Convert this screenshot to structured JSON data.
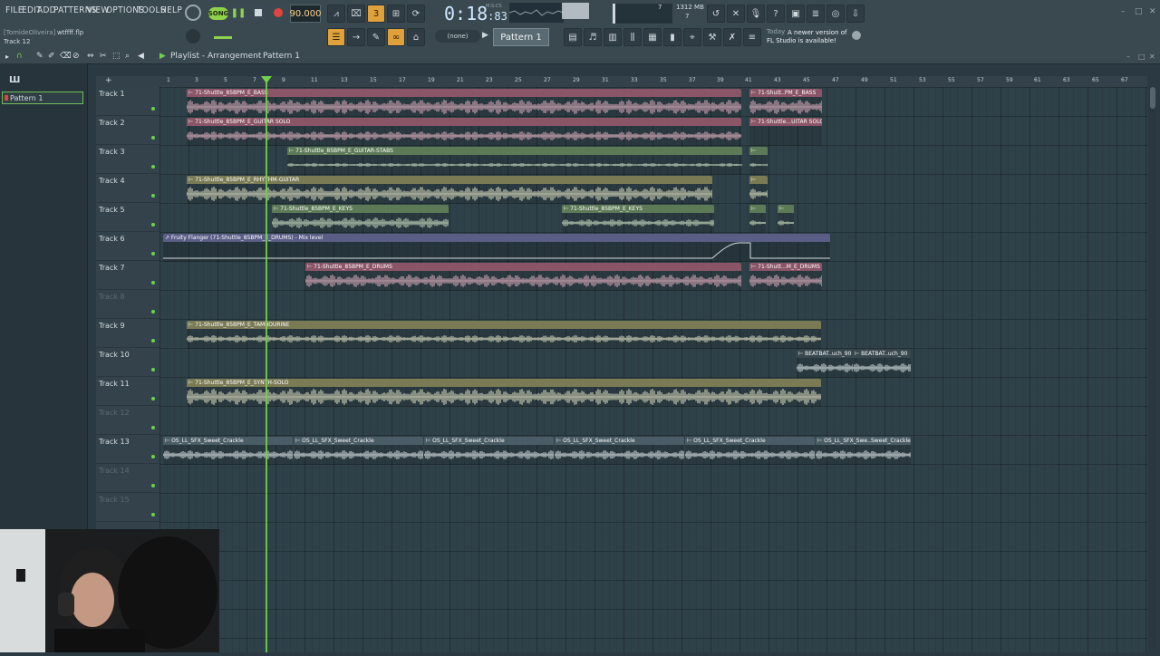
{
  "menu": [
    "FILE",
    "EDIT",
    "ADD",
    "PATTERNS",
    "VIEW",
    "OPTIONS",
    "TOOLS",
    "HELP"
  ],
  "transport": {
    "song_label": "SONG",
    "tempo": "90.000",
    "time_main": "0:18",
    "time_sub": ":83",
    "time_unit_label": "M:S:CS",
    "memory": "1312 MB",
    "memory_num": "7",
    "polyphony": "7"
  },
  "hint": {
    "user": "[TomideOliveira]",
    "file": "wtffff.flp",
    "track": "Track 12"
  },
  "toolbar": {
    "none_label": "(none)",
    "pattern_label": "Pattern 1"
  },
  "news": {
    "today": "Today",
    "line1": "A newer version of",
    "line2": "FL Studio is available!"
  },
  "playlist": {
    "title": "Playlist - Arrangement",
    "arrow": "›",
    "pattern": "Pattern 1",
    "pattern_list_item": "Pattern 1"
  },
  "ruler": [
    "1",
    "3",
    "5",
    "7",
    "9",
    "11",
    "13",
    "15",
    "17",
    "19",
    "21",
    "23",
    "25",
    "27",
    "29",
    "31",
    "33",
    "35",
    "37",
    "39",
    "41",
    "43",
    "45",
    "47",
    "49",
    "51",
    "53",
    "55",
    "57",
    "59",
    "61",
    "63",
    "65",
    "67"
  ],
  "tracks": [
    "Track 1",
    "Track 2",
    "Track 3",
    "Track 4",
    "Track 5",
    "Track 6",
    "Track 7",
    "Track 8",
    "Track 9",
    "Track 10",
    "Track 11",
    "Track 12",
    "Track 13",
    "Track 14",
    "Track 15"
  ],
  "clips": {
    "bass": "71-Shuttle_85BPM_E_BASS",
    "bass2": "71-Shutt..PM_E_BASS",
    "guitar_solo": "71-Shuttle_85BPM_E_GUITAR SOLO",
    "guitar_solo2": "71-Shuttle...UITAR SOLO",
    "guitar_stabs": "71-Shuttle_85BPM_E_GUITAR-STABS",
    "rhythm": "71-Shuttle_85BPM_E_RHYTHM-GUITAR",
    "keys": "71-Shuttle_85BPM_E_KEYS",
    "flanger": "Fruity Flanger (71-Shuttle_85BPM_E_DRUMS) - Mix level",
    "drums": "71-Shuttle_85BPM_E_DRUMS",
    "drums2": "71-Shutt...M_E_DRUMS",
    "tambourine": "71-Shuttle_85BPM_E_TAMBOURINE",
    "beatbat": "BEATBAT..uch_90",
    "synth": "71-Shuttle_85BPM_E_SYNTH-SOLO",
    "crackle": "OS_LL_SFX_Sweet_Crackle",
    "crackle_last": "OS_LL_SFX_Swe..Sweet_Crackle"
  },
  "colors": {
    "accent": "#6fd14b",
    "clip_pink": "#8a5566",
    "clip_green": "#5d7a57",
    "clip_olive": "#7a7a55",
    "clip_purple": "#5a5d86"
  }
}
